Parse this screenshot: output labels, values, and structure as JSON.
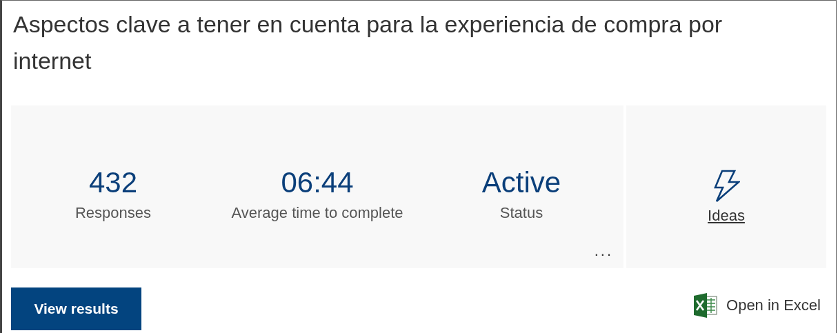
{
  "title": "Aspectos clave a tener en cuenta para la experiencia de compra por internet",
  "stats": [
    {
      "value": "432",
      "label": "Responses"
    },
    {
      "value": "06:44",
      "label": "Average time to complete"
    },
    {
      "value": "Active",
      "label": "Status"
    }
  ],
  "more": "...",
  "ideas": {
    "label": "Ideas"
  },
  "view_results": "View results",
  "open_in_excel": "Open in Excel"
}
